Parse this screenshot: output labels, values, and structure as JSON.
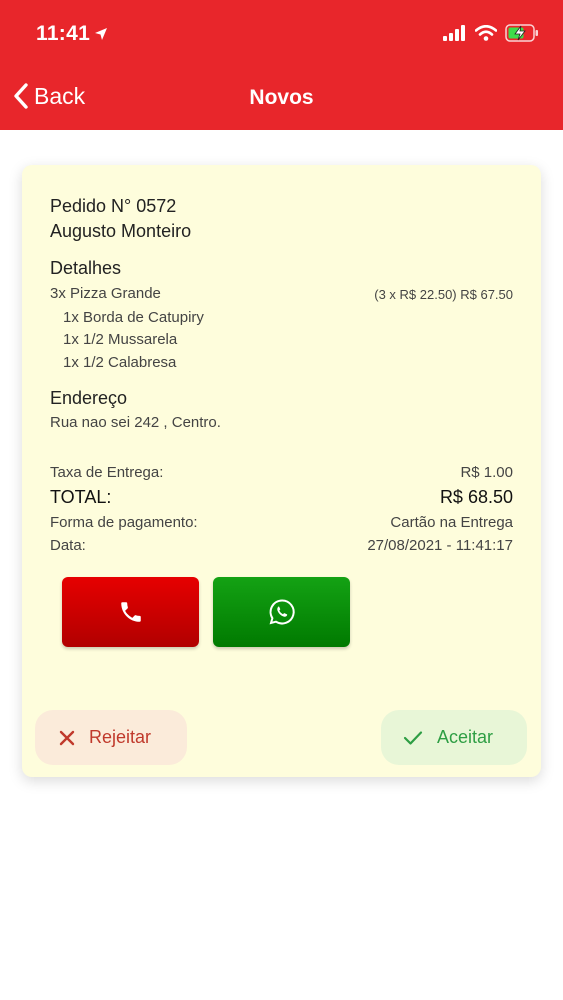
{
  "status_bar": {
    "time": "11:41"
  },
  "nav": {
    "back_label": "Back",
    "title": "Novos"
  },
  "order": {
    "number_label": "Pedido N° 0572",
    "customer": "Augusto Monteiro",
    "details_title": "Detalhes",
    "main_item": "3x Pizza Grande",
    "main_item_price": "(3 x R$ 22.50) R$ 67.50",
    "sub_items": [
      "1x Borda de Catupiry",
      "1x 1/2 Mussarela",
      "1x 1/2 Calabresa"
    ],
    "address_title": "Endereço",
    "address": "Rua nao sei 242 , Centro.",
    "delivery_fee_label": "Taxa de Entrega:",
    "delivery_fee_value": "R$ 1.00",
    "total_label": "TOTAL:",
    "total_value": "R$ 68.50",
    "payment_label": "Forma de pagamento:",
    "payment_value": "Cartão na Entrega",
    "date_label": "Data:",
    "date_value": "27/08/2021 - 11:41:17"
  },
  "actions": {
    "reject_label": "Rejeitar",
    "accept_label": "Aceitar"
  },
  "colors": {
    "header": "#e8262b",
    "card": "#fefddc",
    "phone_button": "#c90000",
    "whatsapp_button": "#0a8f0a",
    "reject_text": "#c0392b",
    "accept_text": "#2e9e44"
  },
  "icons": [
    "location-arrow-icon",
    "signal-icon",
    "wifi-icon",
    "battery-charging-icon",
    "chevron-left-icon",
    "phone-icon",
    "whatsapp-icon",
    "close-icon",
    "check-icon"
  ]
}
